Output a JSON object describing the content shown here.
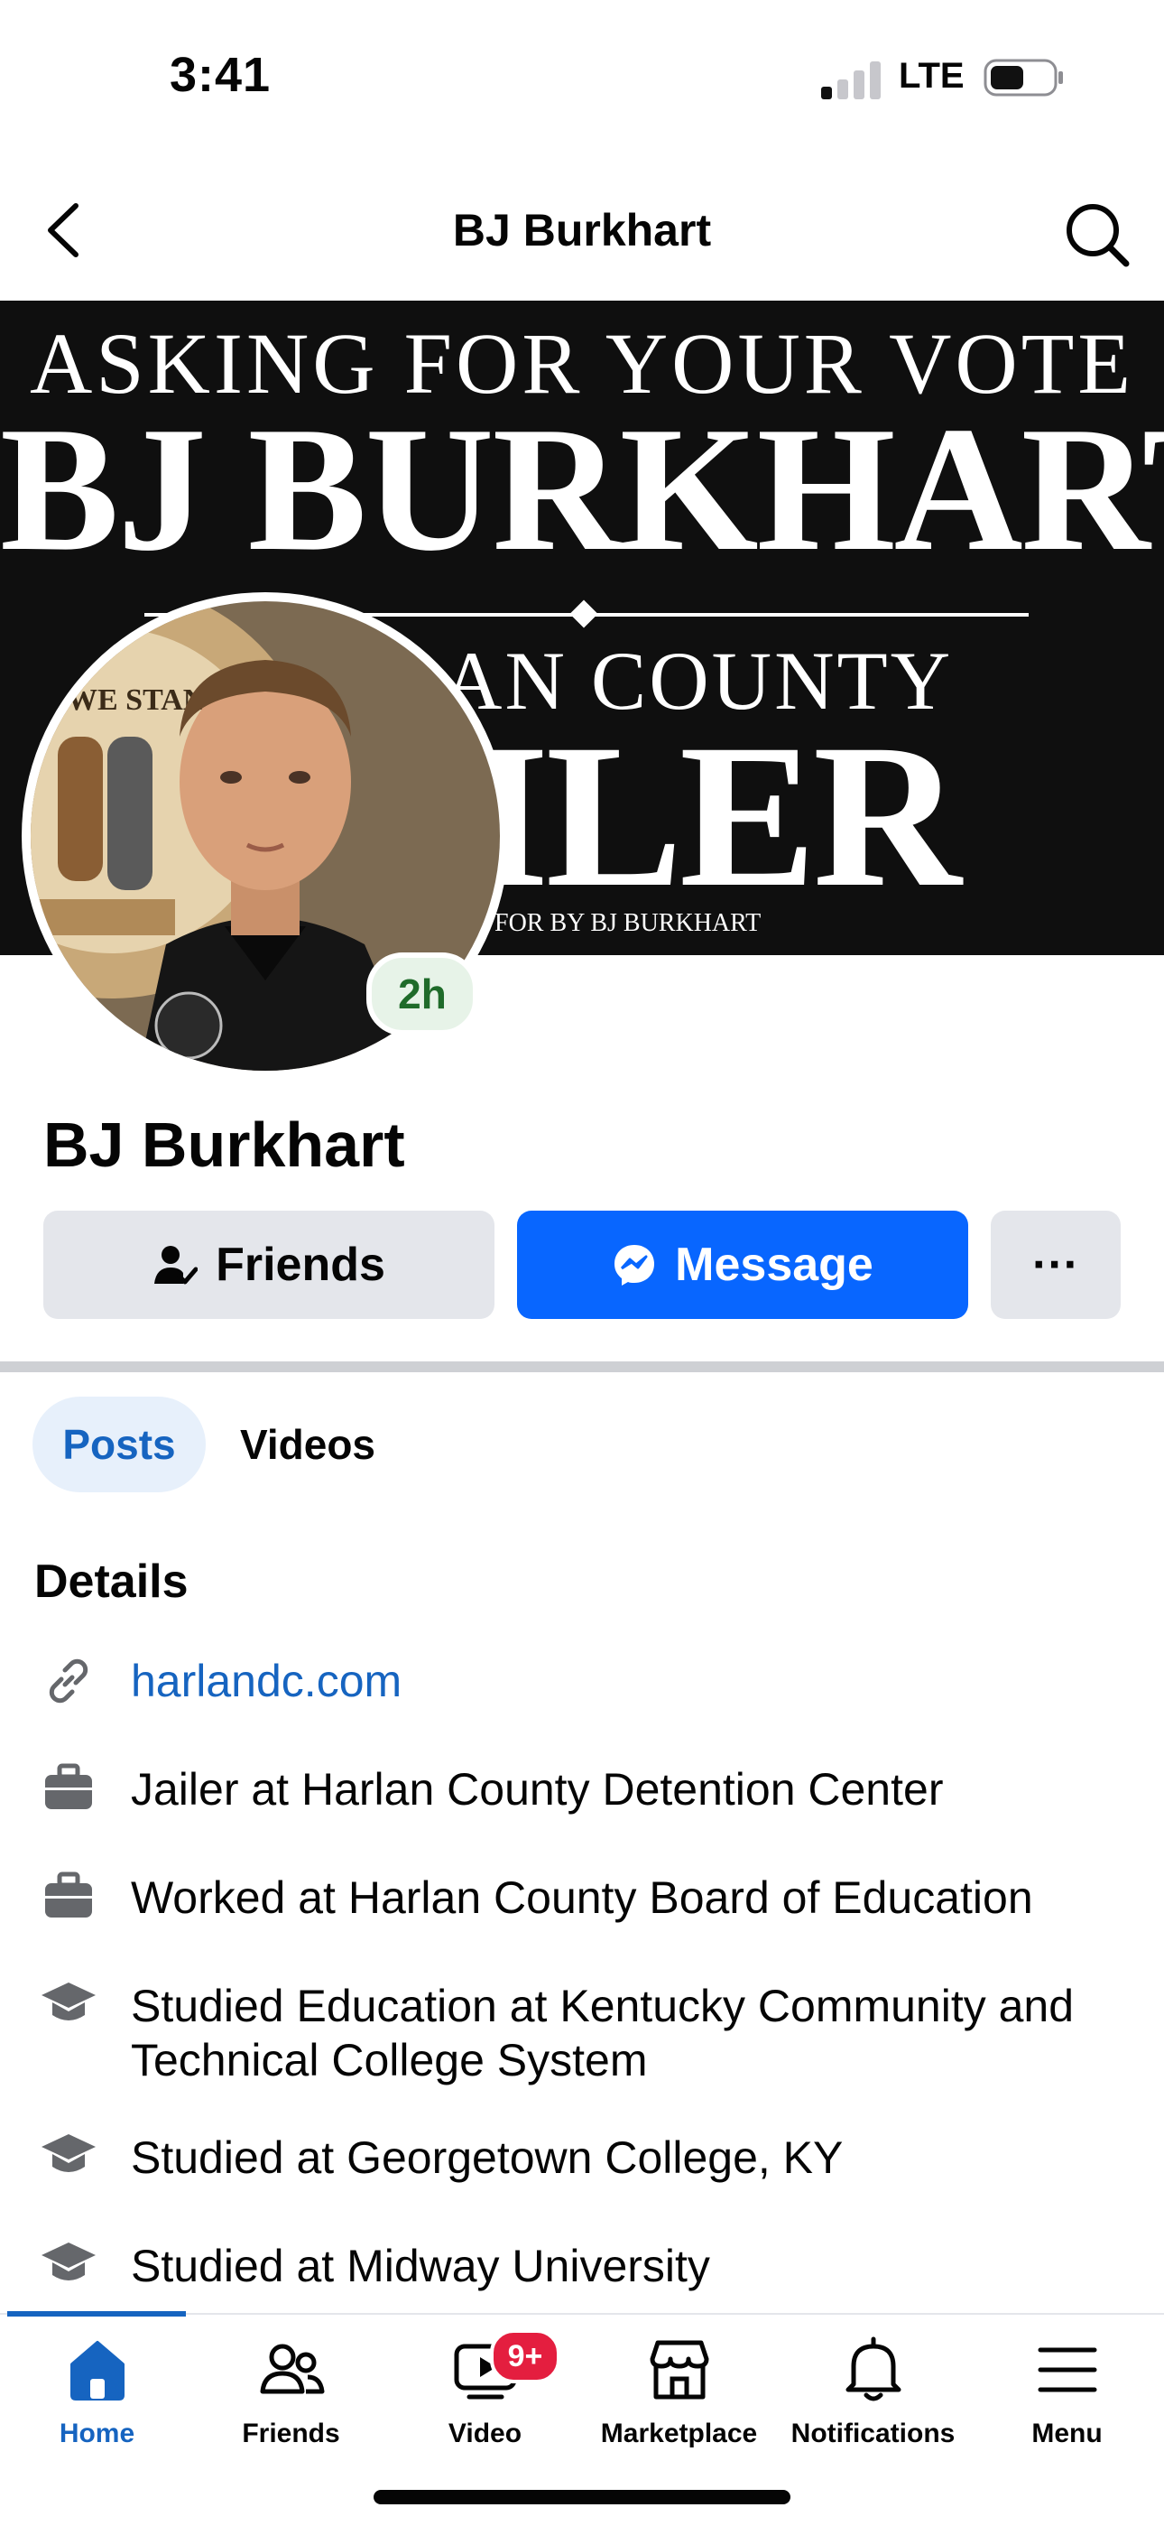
{
  "status_bar": {
    "time": "3:41",
    "network": "LTE"
  },
  "header": {
    "title": "BJ Burkhart"
  },
  "cover": {
    "line1": "ASKING FOR YOUR VOTE",
    "line2": "BJ BURKHART",
    "line3": "AN COUNTY",
    "line4": "ILER",
    "footer": "FOR BY BJ BURKHART"
  },
  "profile": {
    "name": "BJ Burkhart",
    "story_badge": "2h",
    "seal_text": "WE STAND"
  },
  "actions": {
    "friends": "Friends",
    "message": "Message",
    "more": "···"
  },
  "tabs": [
    {
      "label": "Posts",
      "active": true
    },
    {
      "label": "Videos",
      "active": false
    }
  ],
  "details": {
    "title": "Details",
    "items": [
      {
        "icon": "link-icon",
        "text": "harlandc.com"
      },
      {
        "icon": "briefcase-icon",
        "text": "Jailer at Harlan County Detention Center"
      },
      {
        "icon": "briefcase-icon",
        "text": "Worked at Harlan County Board of Education"
      },
      {
        "icon": "graduation-cap-icon",
        "text": "Studied Education at Kentucky Community and Technical College System"
      },
      {
        "icon": "graduation-cap-icon",
        "text": "Studied at Georgetown College, KY"
      },
      {
        "icon": "graduation-cap-icon",
        "text": "Studied at Midway University"
      }
    ]
  },
  "nav": {
    "items": [
      {
        "label": "Home",
        "icon": "home-icon",
        "active": true
      },
      {
        "label": "Friends",
        "icon": "friends-icon"
      },
      {
        "label": "Video",
        "icon": "video-icon",
        "badge": "9+"
      },
      {
        "label": "Marketplace",
        "icon": "marketplace-icon"
      },
      {
        "label": "Notifications",
        "icon": "bell-icon"
      },
      {
        "label": "Menu",
        "icon": "menu-icon"
      }
    ]
  },
  "colors": {
    "accent": "#0866ff",
    "link": "#1664c0",
    "badge_red": "#e41e3f",
    "cover_bg": "#0f0f0f"
  }
}
